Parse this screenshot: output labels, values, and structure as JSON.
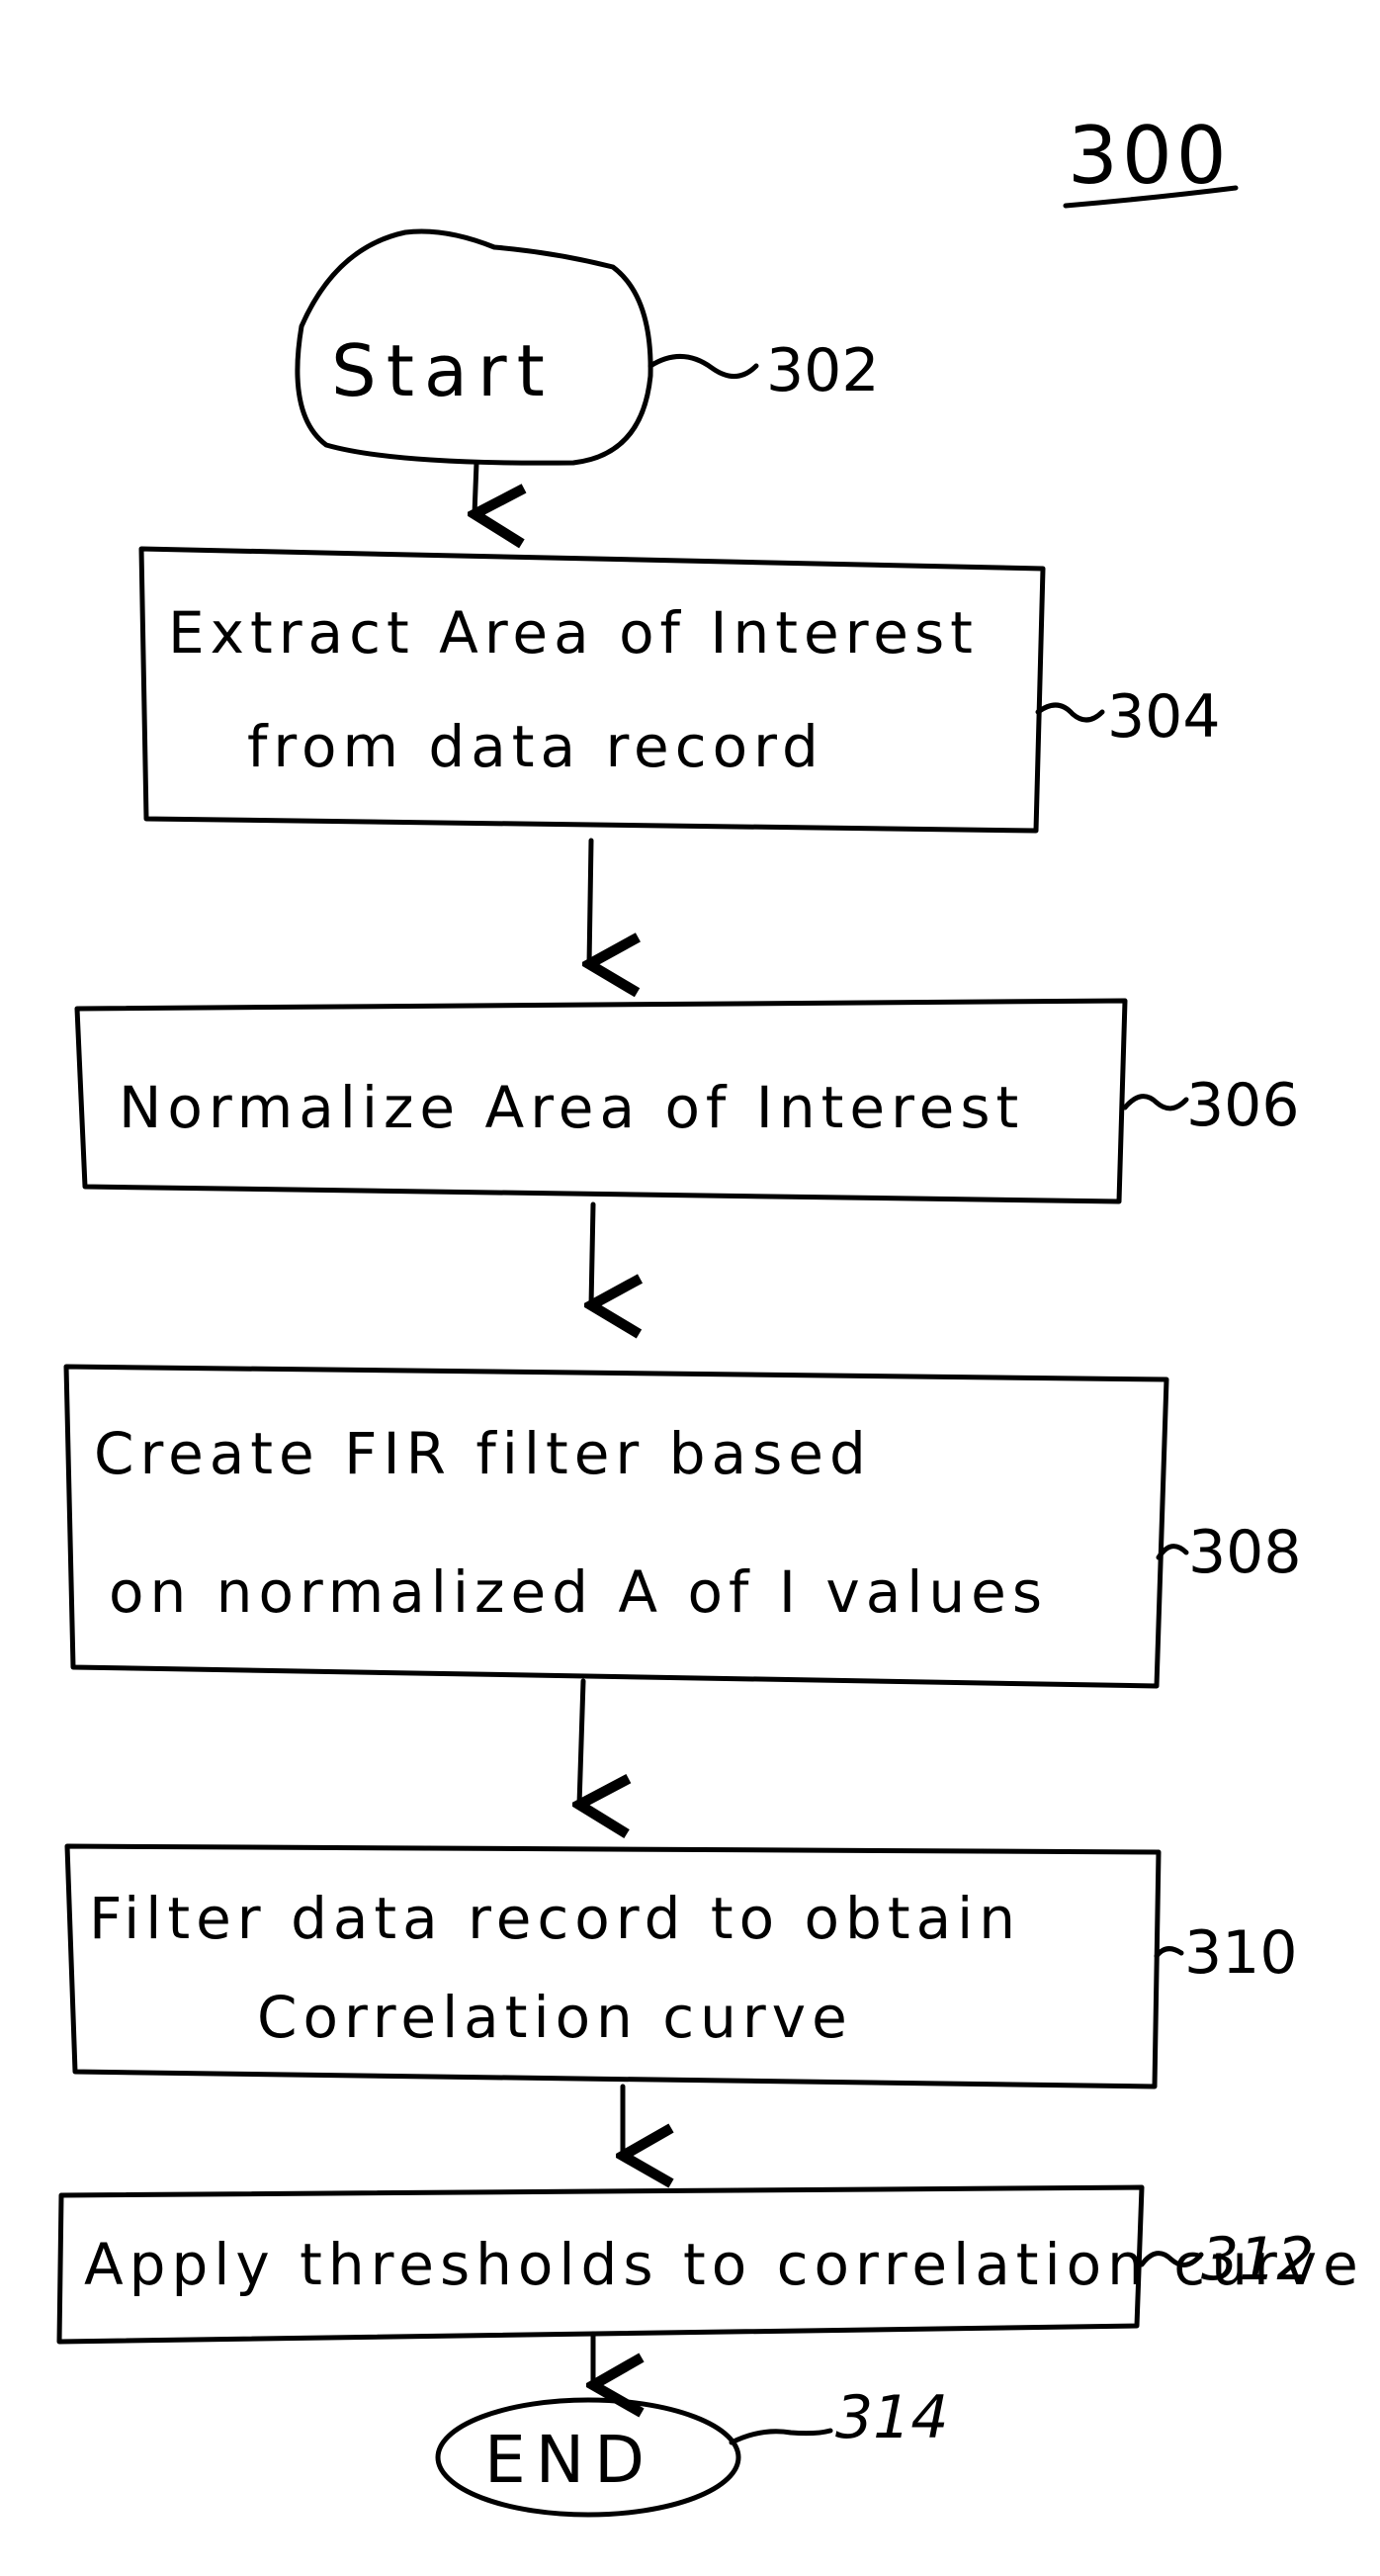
{
  "figure": {
    "number": "300"
  },
  "start": {
    "label": "Start",
    "ref": "302"
  },
  "steps": [
    {
      "ref": "304",
      "lines": [
        "Extract Area of Interest",
        "from data record"
      ]
    },
    {
      "ref": "306",
      "lines": [
        "Normalize Area of Interest"
      ]
    },
    {
      "ref": "308",
      "lines": [
        "Create FIR filter based",
        "on normalized A of I values"
      ]
    },
    {
      "ref": "310",
      "lines": [
        "Filter data record to obtain",
        "Correlation curve"
      ]
    },
    {
      "ref": "312",
      "lines": [
        "Apply thresholds to correlation curve"
      ]
    }
  ],
  "end": {
    "label": "END",
    "ref": "314"
  }
}
